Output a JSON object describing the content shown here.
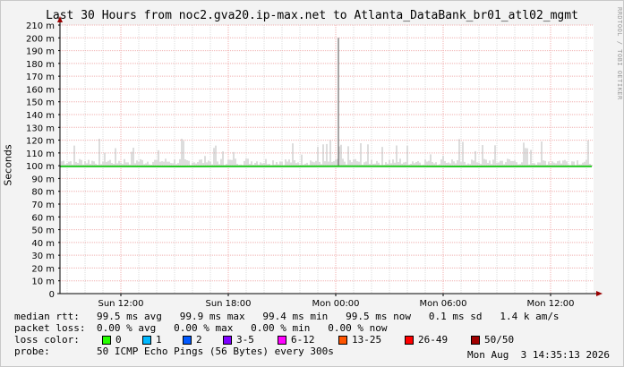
{
  "title": "Last 30 Hours from noc2.gva20.ip-max.net to Atlanta_DataBank_br01_atl02_mgmt",
  "watermark": "RRDTOOL / TOBI OETIKER",
  "colors": {
    "grid": "#f0b0b0",
    "minor": "#dddddd",
    "median": "#22cc22",
    "smoke": "#bbbbbb",
    "axis": "#000000",
    "arrow": "#990000"
  },
  "chart_data": {
    "type": "line",
    "ylabel": "Seconds",
    "ylim": [
      0,
      210
    ],
    "yticks": [
      "0",
      "10 m",
      "20 m",
      "30 m",
      "40 m",
      "50 m",
      "60 m",
      "70 m",
      "80 m",
      "90 m",
      "100 m",
      "110 m",
      "120 m",
      "130 m",
      "140 m",
      "150 m",
      "160 m",
      "170 m",
      "180 m",
      "190 m",
      "200 m",
      "210 m"
    ],
    "xticks": [
      "Sun 12:00",
      "Sun 18:00",
      "Mon 00:00",
      "Mon 06:00",
      "Mon 12:00"
    ],
    "series": [
      {
        "name": "median rtt",
        "values": [
          99.5,
          99.5,
          99.4,
          99.5,
          99.5,
          99.6,
          99.5,
          99.4,
          99.5,
          99.5
        ]
      }
    ],
    "spike": {
      "x": "Mon 00:00",
      "y": 200
    }
  },
  "stats": {
    "median_label": "median rtt:",
    "median_values": "99.5 ms avg   99.9 ms max   99.4 ms min   99.5 ms now   0.1 ms sd   1.4 k am/s",
    "loss_label": "packet loss:",
    "loss_values": "0.00 % avg   0.00 % max   0.00 % min   0.00 % now",
    "color_label": "loss color:",
    "probe_label": "probe:",
    "probe_values": "50 ICMP Echo Pings (56 Bytes) every 300s",
    "date": "Mon Aug  3 14:35:13 2026"
  },
  "loss_colors": [
    {
      "label": "0",
      "color": "#26ff00"
    },
    {
      "label": "1",
      "color": "#00b8ff"
    },
    {
      "label": "2",
      "color": "#0059ff"
    },
    {
      "label": "3-5",
      "color": "#7e00ff"
    },
    {
      "label": "6-12",
      "color": "#ff00ff"
    },
    {
      "label": "13-25",
      "color": "#ff5500"
    },
    {
      "label": "26-49",
      "color": "#ff0000"
    },
    {
      "label": "50/50",
      "color": "#a10000"
    }
  ]
}
